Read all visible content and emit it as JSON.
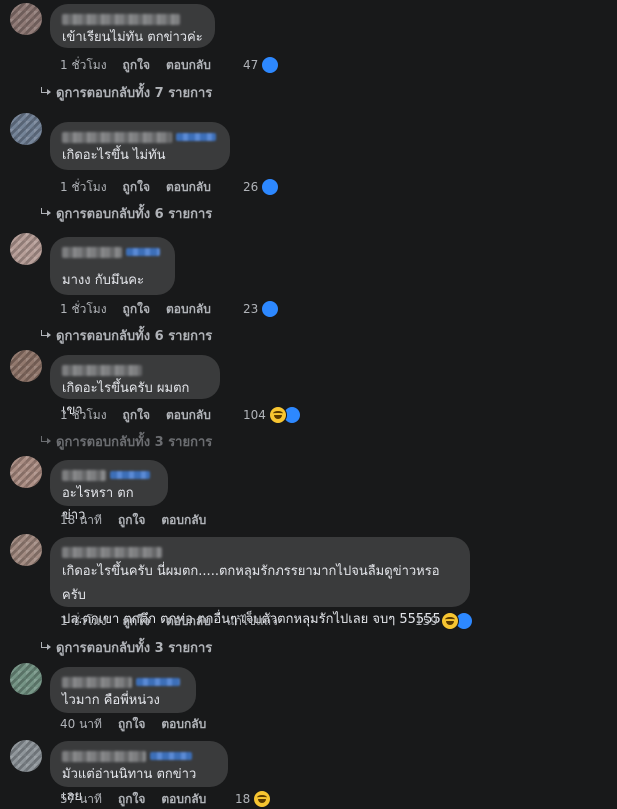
{
  "labels": {
    "like": "ถูกใจ",
    "reply": "ตอบกลับ",
    "edited": "แก้ไขแล้ว"
  },
  "colors": {
    "background": "#18191a",
    "bubble": "#3a3b3c",
    "meta": "#b0b3b8",
    "like": "#2d88ff",
    "haha": "#f7c531"
  },
  "comments": [
    {
      "text": "เข้าเรียนไม่ทัน ตกข่าวค่ะ",
      "time": "1 ชั่วโมง",
      "reactions": "47",
      "reaction_icons": [
        "like-icon"
      ],
      "replies": "ดูการตอบกลับทั้ง 7 รายการ"
    },
    {
      "text": "เกิดอะไรขึ้น ไม่ทัน",
      "time": "1 ชั่วโมง",
      "reactions": "26",
      "reaction_icons": [
        "like-icon"
      ],
      "replies": "ดูการตอบกลับทั้ง 6 รายการ"
    },
    {
      "text": "มางง กับมึนคะ",
      "time": "1 ชั่วโมง",
      "reactions": "23",
      "reaction_icons": [
        "like-icon"
      ],
      "replies": "ดูการตอบกลับทั้ง 6 รายการ"
    },
    {
      "text": "เกิดอะไรขึ้นครับ ผมตกเขา",
      "time": "1 ชั่วโมง",
      "reactions": "104",
      "reaction_icons": [
        "haha-icon",
        "like-icon"
      ],
      "replies": "ดูการตอบกลับทั้ง 3 รายการ"
    },
    {
      "text": "อะไรหรา ตกข่าว",
      "time": "18 นาที",
      "reactions": "",
      "reaction_icons": [],
      "replies": ""
    },
    {
      "text": "เกิดอะไรขึ้นครับ นี่ผมตก.....ตกหลุมรักภรรยามากไปจนลืมดูข่าวหรอครับ\nปล.ตกเขา ตกตึก ตกท่อ ตกอื่นๆ เจ็บตัวตกหลุมรักไปเลย จบๆ 55555",
      "time": "1 ชั่วโมง",
      "reactions": "159",
      "reaction_icons": [
        "haha-icon",
        "like-icon"
      ],
      "replies": "ดูการตอบกลับทั้ง 3 รายการ",
      "edited": true
    },
    {
      "text": "ไวมาก คือพี่หน่วง",
      "time": "40 นาที",
      "reactions": "",
      "reaction_icons": [],
      "replies": ""
    },
    {
      "text": "มัวแต่อ่านนิทาน ตกข่าวเลย",
      "time": "57 นาที",
      "reactions": "18",
      "reaction_icons": [
        "haha-icon"
      ],
      "replies": ""
    }
  ]
}
